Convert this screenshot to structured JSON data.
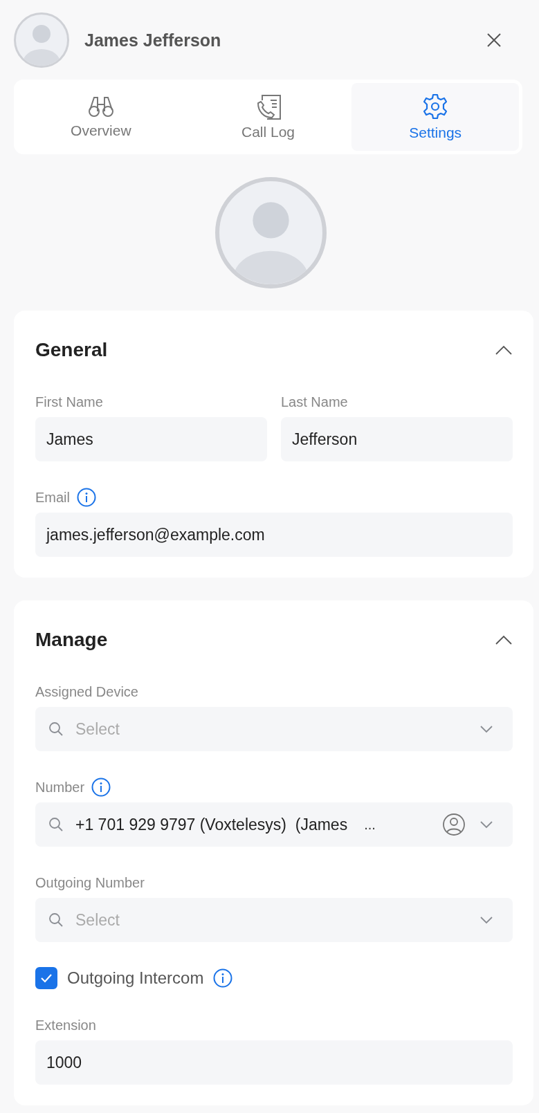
{
  "header": {
    "name": "James Jefferson"
  },
  "tabs": [
    {
      "label": "Overview",
      "selected": false
    },
    {
      "label": "Call Log",
      "selected": false
    },
    {
      "label": "Settings",
      "selected": true
    }
  ],
  "sections": [
    {
      "title": "General",
      "expanded": true,
      "items": [
        {
          "kind": "pair",
          "fields": [
            {
              "label": "First Name",
              "value": "James"
            },
            {
              "label": "Last Name",
              "value": "Jefferson"
            }
          ]
        },
        {
          "kind": "text",
          "label": "Email",
          "info": true,
          "value": "james.jefferson@example.com"
        }
      ]
    },
    {
      "title": "Manage",
      "expanded": true,
      "items": [
        {
          "kind": "select",
          "label": "Assigned Device",
          "info": false,
          "placeholder": "Select"
        },
        {
          "kind": "select",
          "label": "Number",
          "info": true,
          "value": "+1 701 929 9797 (Voxtelesys)  (James",
          "more": "...",
          "person": true
        },
        {
          "kind": "select",
          "label": "Outgoing Number",
          "info": false,
          "placeholder": "Select"
        },
        {
          "kind": "checkbox",
          "label": "Outgoing Intercom",
          "info": true,
          "checked": true
        },
        {
          "kind": "text",
          "label": "Extension",
          "info": false,
          "value": "1000"
        }
      ]
    }
  ]
}
